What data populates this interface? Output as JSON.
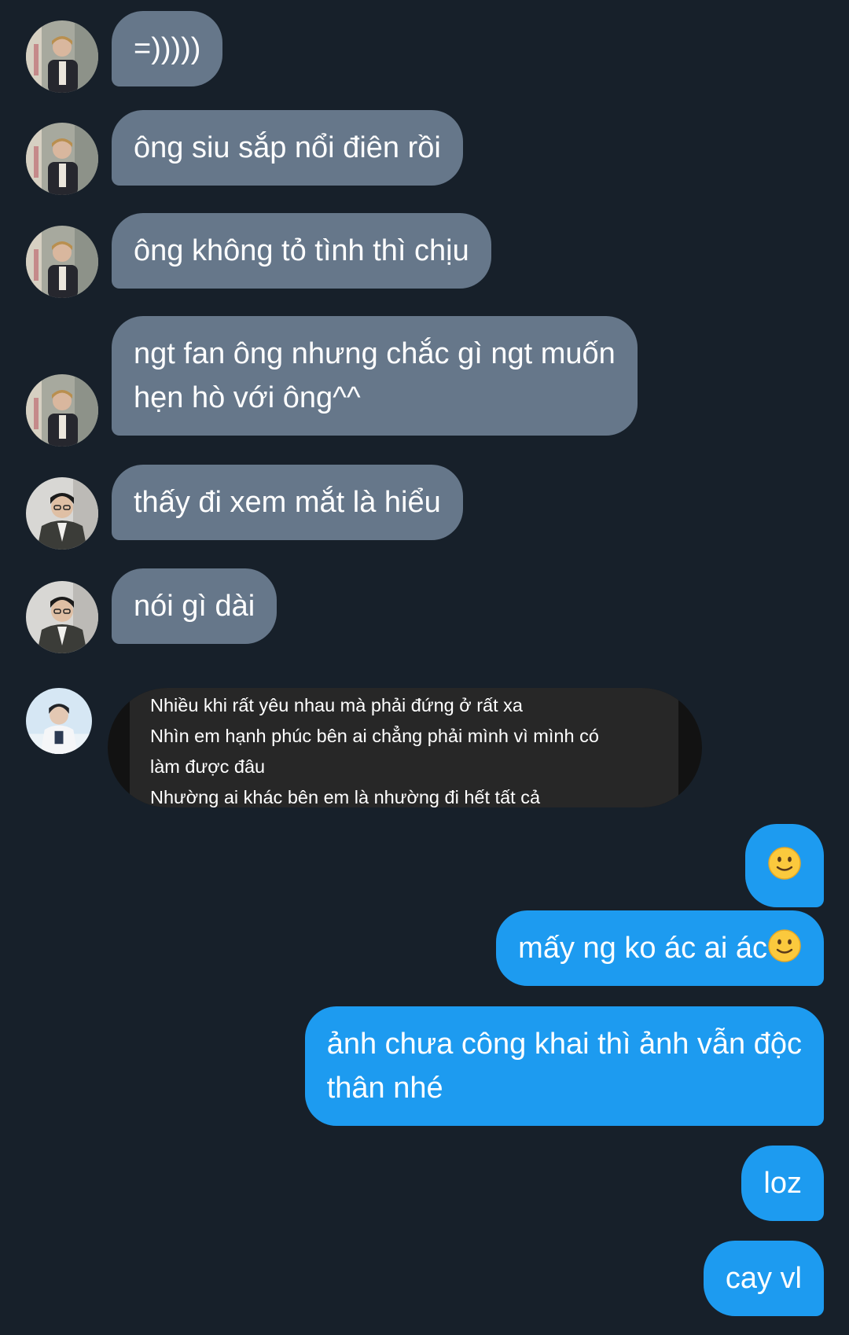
{
  "chat": {
    "messages": [
      {
        "id": 1,
        "direction": "incoming",
        "avatar": "avatar-user-a",
        "lines": [
          "=)))))"
        ]
      },
      {
        "id": 2,
        "direction": "incoming",
        "avatar": "avatar-user-a",
        "lines": [
          "ông siu sắp nổi điên rồi"
        ]
      },
      {
        "id": 3,
        "direction": "incoming",
        "avatar": "avatar-user-a",
        "lines": [
          "ông không tỏ tình thì chịu"
        ]
      },
      {
        "id": 4,
        "direction": "incoming",
        "avatar": "avatar-user-a",
        "lines": [
          "ngt fan ông nhưng chắc gì ngt muốn",
          "hẹn hò với ông^^"
        ]
      },
      {
        "id": 5,
        "direction": "incoming",
        "avatar": "avatar-user-b",
        "lines": [
          "thấy đi xem mắt là hiểu"
        ]
      },
      {
        "id": 6,
        "direction": "incoming",
        "avatar": "avatar-user-b",
        "lines": [
          "nói gì dài"
        ]
      },
      {
        "id": 7,
        "direction": "incoming",
        "avatar": "avatar-user-c",
        "type": "shared-media",
        "lines": [
          "Nhiều khi rất yêu nhau mà phải đứng ở rất xa",
          "Nhìn em hạnh phúc bên ai chẳng phải mình vì mình có",
          "làm được đâu",
          "Nhường ai khác bên em là nhường đi hết tất cả"
        ]
      },
      {
        "id": 8,
        "direction": "outgoing",
        "emoji": "slightly-smiling-face-icon",
        "lines": [
          ""
        ]
      },
      {
        "id": 9,
        "direction": "outgoing",
        "emoji": "slightly-smiling-face-icon",
        "lines": [
          "mấy ng ko ác ai ác"
        ]
      },
      {
        "id": 10,
        "direction": "outgoing",
        "lines": [
          "ảnh chưa công khai thì ảnh vẫn độc",
          "thân nhé"
        ]
      },
      {
        "id": 11,
        "direction": "outgoing",
        "lines": [
          "loz"
        ]
      },
      {
        "id": 12,
        "direction": "outgoing",
        "lines": [
          "cay vl"
        ]
      }
    ]
  },
  "colors": {
    "background": "#17202a",
    "incoming_bubble": "#66778a",
    "outgoing_bubble": "#1d9bf0",
    "shared_card": "#272727",
    "text": "#ffffff"
  }
}
